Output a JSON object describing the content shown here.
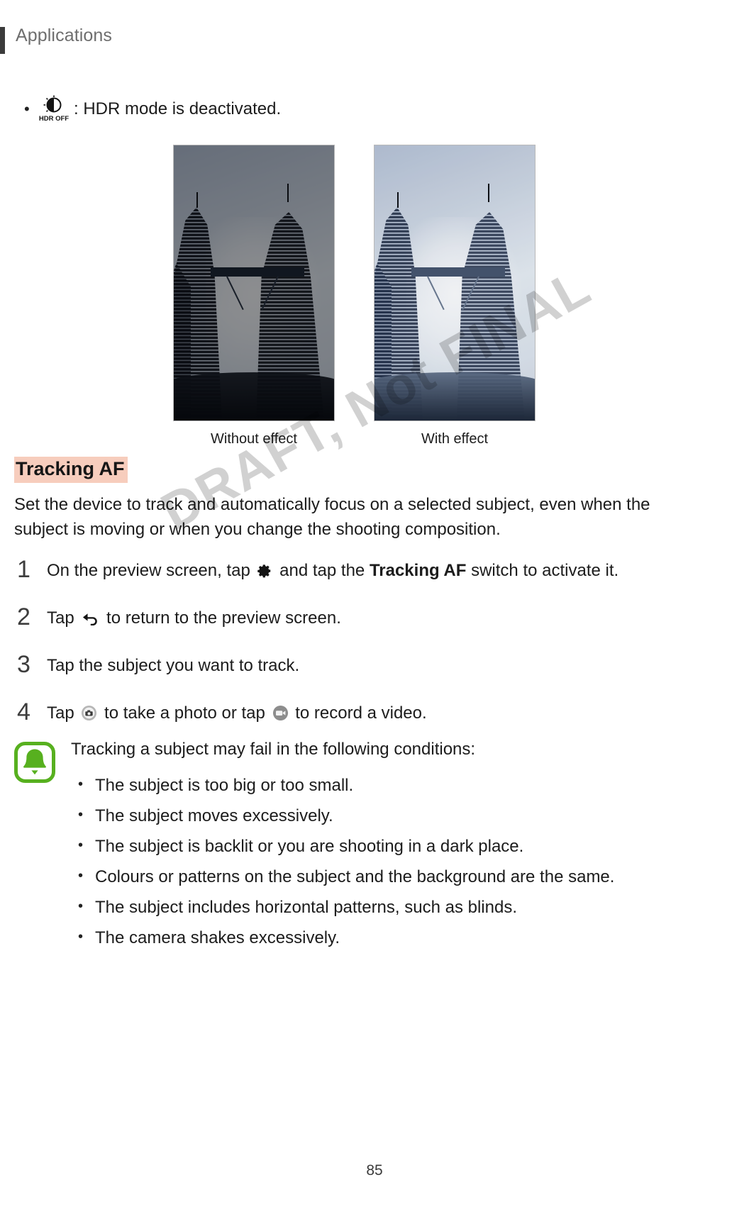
{
  "header": {
    "title": "Applications"
  },
  "hdr_note": {
    "icon": "hdr-off-icon",
    "icon_label": "HDR OFF",
    "bullet": "•",
    "text": ": HDR mode is deactivated."
  },
  "figures": [
    {
      "name": "sample-photo-without-hdr",
      "caption": "Without effect"
    },
    {
      "name": "sample-photo-with-hdr",
      "caption": "With effect"
    }
  ],
  "section": {
    "heading": "Tracking AF",
    "paragraph": "Set the device to track and automatically focus on a selected subject, even when the subject is moving or when you change the shooting composition."
  },
  "steps": [
    {
      "number": "1",
      "prefix": "On the preview screen, tap ",
      "icon": "gear-icon",
      "middle": " and tap the ",
      "bold": "Tracking AF",
      "suffix": " switch to activate it."
    },
    {
      "number": "2",
      "prefix": "Tap ",
      "icon": "back-arrow-icon",
      "middle": "",
      "bold": "",
      "suffix": " to return to the preview screen."
    },
    {
      "number": "3",
      "prefix": "Tap the subject you want to track.",
      "icon": "",
      "middle": "",
      "bold": "",
      "suffix": ""
    },
    {
      "number": "4",
      "prefix": "Tap ",
      "icon": "camera-shutter-icon",
      "middle": " to take a photo or tap ",
      "icon2": "video-record-icon",
      "bold": "",
      "suffix": " to record a video."
    }
  ],
  "note": {
    "icon": "bell-note-icon",
    "title": "Tracking a subject may fail in the following conditions:",
    "items": [
      "The subject is too big or too small.",
      "The subject moves excessively.",
      "The subject is backlit or you are shooting in a dark place.",
      "Colours or patterns on the subject and the background are the same.",
      "The subject includes horizontal patterns, such as blinds.",
      "The camera shakes excessively."
    ]
  },
  "watermark": "DRAFT, Not FINAL",
  "page_number": "85",
  "colors": {
    "heading_highlight": "#f7cdbd",
    "note_icon_green": "#57b01f",
    "header_text": "#6e6e6e",
    "body_text": "#1c1c1c"
  }
}
